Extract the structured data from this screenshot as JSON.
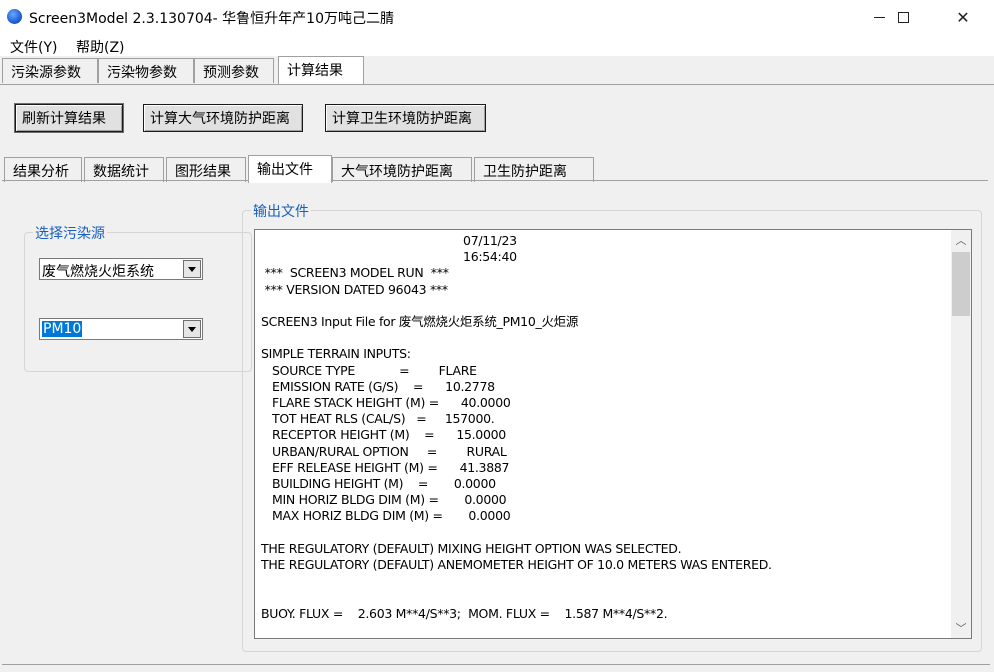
{
  "window": {
    "title": "Screen3Model 2.3.130704- 华鲁恒升年产10万吨己二腈",
    "minimize_glyph": "",
    "close_glyph": "✕"
  },
  "menu": {
    "items": [
      "文件(Y)",
      "帮助(Z)"
    ]
  },
  "top_tabs": [
    "污染源参数",
    "污染物参数",
    "预测参数",
    "计算结果"
  ],
  "toolbar": {
    "refresh_label": "刷新计算结果",
    "atmos_distance_label": "计算大气环境防护距离",
    "health_distance_label": "计算卫生环境防护距离"
  },
  "inner_tabs": [
    "结果分析",
    "数据统计",
    "图形结果",
    "输出文件",
    "大气环境防护距离",
    "卫生防护距离"
  ],
  "source_group": {
    "title": "选择污染源",
    "source_select": "废气燃烧火炬系统",
    "pollutant_select": "PM10"
  },
  "output_group": {
    "title": "输出文件",
    "lines": [
      "                                                       07/11/23",
      "                                                       16:54:40",
      " ***  SCREEN3 MODEL RUN  ***",
      " *** VERSION DATED 96043 ***",
      "",
      "SCREEN3 Input File for 废气燃烧火炬系统_PM10_火炬源",
      "",
      "SIMPLE TERRAIN INPUTS:",
      "   SOURCE TYPE            =        FLARE",
      "   EMISSION RATE (G/S)    =      10.2778",
      "   FLARE STACK HEIGHT (M) =      40.0000",
      "   TOT HEAT RLS (CAL/S)   =     157000.",
      "   RECEPTOR HEIGHT (M)    =      15.0000",
      "   URBAN/RURAL OPTION     =        RURAL",
      "   EFF RELEASE HEIGHT (M) =      41.3887",
      "   BUILDING HEIGHT (M)    =       0.0000",
      "   MIN HORIZ BLDG DIM (M) =       0.0000",
      "   MAX HORIZ BLDG DIM (M) =       0.0000",
      "",
      "THE REGULATORY (DEFAULT) MIXING HEIGHT OPTION WAS SELECTED.",
      "THE REGULATORY (DEFAULT) ANEMOMETER HEIGHT OF 10.0 METERS WAS ENTERED.",
      "",
      "",
      "BUOY. FLUX =    2.603 M**4/S**3;  MOM. FLUX =    1.587 M**4/S**2."
    ]
  }
}
